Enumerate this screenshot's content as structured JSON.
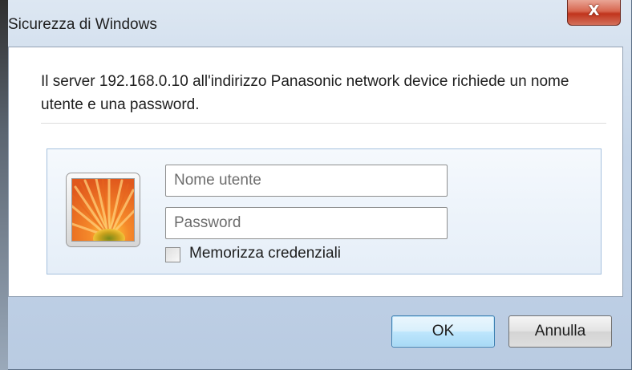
{
  "window": {
    "title": "Sicurezza di Windows",
    "close_glyph": "X"
  },
  "dialog": {
    "message": "Il server 192.168.0.10 all'indirizzo Panasonic network device richiede un nome utente e una password.",
    "username_placeholder": "Nome utente",
    "username_value": "",
    "password_placeholder": "Password",
    "password_value": "",
    "remember_label": "Memorizza credenziali",
    "remember_checked": false,
    "avatar_icon": "orange-flower-user-tile-icon"
  },
  "buttons": {
    "ok_label": "OK",
    "cancel_label": "Annulla"
  },
  "colors": {
    "close_button": "#c9472f",
    "panel_border": "#a6c1de",
    "default_button_border": "#3c7fb1"
  }
}
